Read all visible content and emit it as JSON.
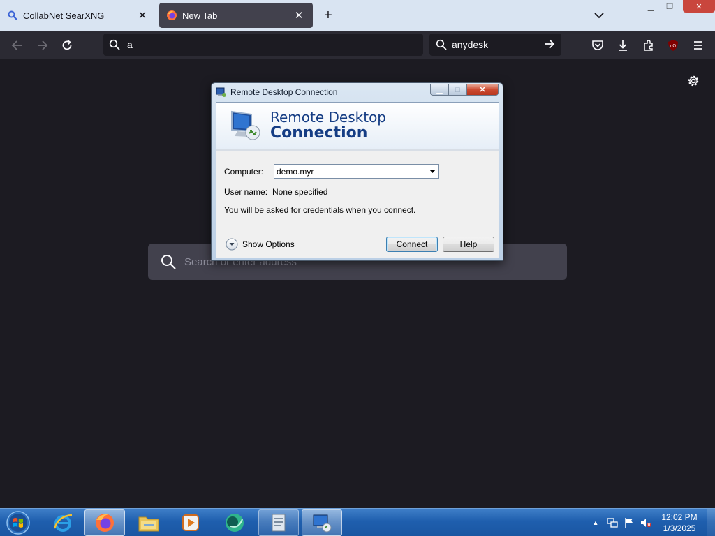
{
  "browser": {
    "tabs": [
      {
        "label": "CollabNet SearXNG",
        "active": false
      },
      {
        "label": "New Tab",
        "active": true
      }
    ],
    "url_value": "a",
    "search_value": "anydesk",
    "newtab_search_placeholder": "Search or enter address"
  },
  "dialog": {
    "window_title": "Remote Desktop Connection",
    "heading_line1": "Remote Desktop",
    "heading_line2": "Connection",
    "computer_label": "Computer:",
    "computer_value": "demo.myr",
    "username_label": "User name:",
    "username_value": "None specified",
    "credentials_note": "You will be asked for credentials when you connect.",
    "show_options_label": "Show Options",
    "connect_label": "Connect",
    "help_label": "Help"
  },
  "taskbar": {
    "items": [
      "internet-explorer",
      "firefox",
      "windows-explorer",
      "media-player",
      "anydesk-app",
      "file-manager",
      "remote-desktop"
    ],
    "clock_time": "12:02 PM",
    "clock_date": "1/3/2025"
  },
  "colors": {
    "browser_bg": "#1c1b22",
    "toolbar_bg": "#2b2a33",
    "tabstrip_bg": "#d9e4f2",
    "dialog_heading": "#153d84",
    "taskbar": "#1f5fae"
  }
}
